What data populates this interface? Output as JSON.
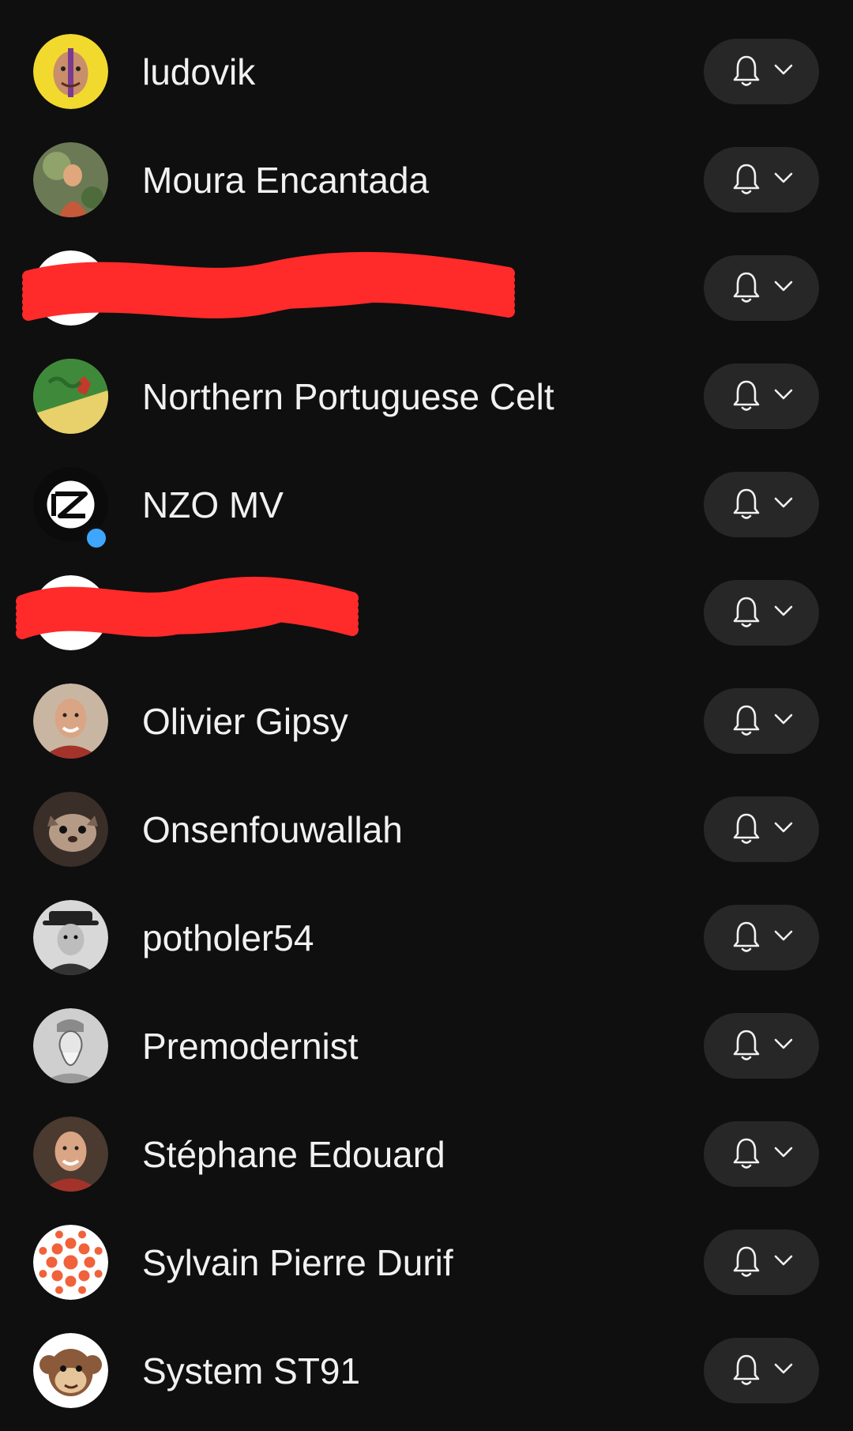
{
  "subscriptions": [
    {
      "name": "ludovik",
      "avatar": "yellow-face-avatar",
      "bg": "#f2d92e"
    },
    {
      "name": "Moura Encantada",
      "avatar": "painting-avatar",
      "bg": "#6b7a55"
    },
    {
      "name": "",
      "avatar": "redacted-avatar",
      "bg": "#ffffff",
      "redacted": true
    },
    {
      "name": "Northern Portuguese Celt",
      "avatar": "flag-avatar",
      "bg": "#d9b24a"
    },
    {
      "name": "NZO MV",
      "avatar": "nzo-logo-avatar",
      "bg": "#0b0b0b",
      "new_content": true
    },
    {
      "name": "",
      "avatar": "redacted-avatar",
      "bg": "#ffffff",
      "redacted": true
    },
    {
      "name": "Olivier Gipsy",
      "avatar": "man-photo-avatar",
      "bg": "#c9b6a2"
    },
    {
      "name": "Onsenfouwallah",
      "avatar": "cat-photo-avatar",
      "bg": "#3a2e28"
    },
    {
      "name": "potholer54",
      "avatar": "bw-portrait-avatar",
      "bg": "#d8d8d8"
    },
    {
      "name": "Premodernist",
      "avatar": "engraving-avatar",
      "bg": "#cfcfcf"
    },
    {
      "name": "Stéphane Edouard",
      "avatar": "man-photo-avatar",
      "bg": "#4a3a30"
    },
    {
      "name": "Sylvain Pierre Durif",
      "avatar": "dots-logo-avatar",
      "bg": "#ffffff"
    },
    {
      "name": "System ST91",
      "avatar": "monkey-cartoon-avatar",
      "bg": "#ffffff"
    }
  ],
  "icons": {
    "bell": "bell-icon",
    "chevron": "chevron-down-icon"
  },
  "colors": {
    "background": "#0f0f0f",
    "button": "#272727",
    "text": "#f1f1f1",
    "new_dot": "#3ea6ff",
    "redaction": "#ff2a2a"
  }
}
